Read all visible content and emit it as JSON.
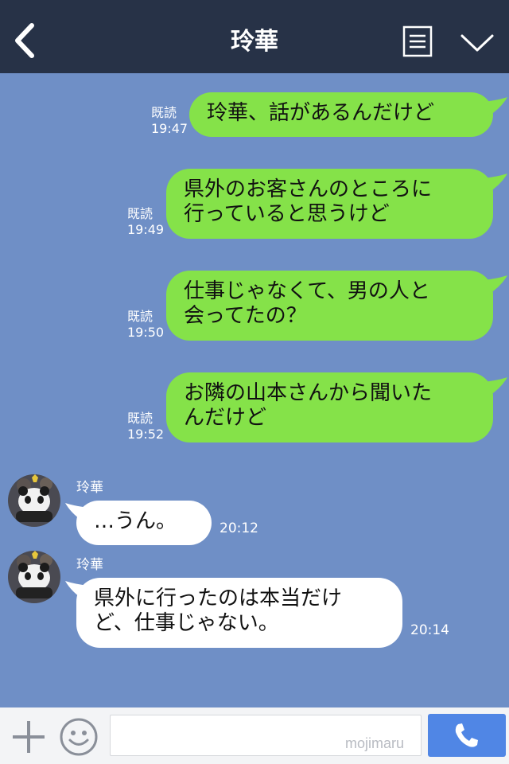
{
  "header": {
    "title": "玲華"
  },
  "contact_name": "玲華",
  "outgoing": [
    {
      "lines": [
        "玲華、話があるんだけど"
      ],
      "read": "既読",
      "time": "19:47"
    },
    {
      "lines": [
        "県外のお客さんのところに",
        "行っていると思うけど"
      ],
      "read": "既読",
      "time": "19:49"
    },
    {
      "lines": [
        "仕事じゃなくて、男の人と",
        "会ってたの？"
      ],
      "read": "既読",
      "time": "19:50"
    },
    {
      "lines": [
        "お隣の山本さんから聞いた",
        "んだけど"
      ],
      "read": "既読",
      "time": "19:52"
    }
  ],
  "incoming": [
    {
      "sender": "玲華",
      "lines": [
        "…うん。"
      ],
      "time": "20:12"
    },
    {
      "sender": "玲華",
      "lines": [
        "県外に行ったのは本当だけ",
        "ど、仕事じゃない。"
      ],
      "time": "20:14"
    }
  ],
  "composer": {
    "placeholder": "",
    "watermark": "mojimaru"
  },
  "icons": [
    "back-arrow-icon",
    "notes-icon",
    "chevron-down-icon",
    "plus-icon",
    "smile-icon",
    "phone-icon"
  ],
  "colors": {
    "header": "#273247",
    "background": "#6f8fc6",
    "outgoing_bubble": "#85e249",
    "incoming_bubble": "#ffffff",
    "call_button": "#5086e5"
  }
}
